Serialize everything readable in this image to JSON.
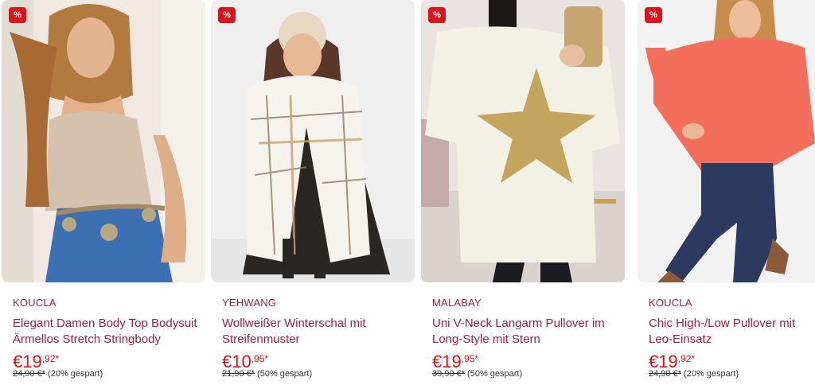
{
  "badge": "%",
  "colors": {
    "brand_text": "#9a2145",
    "price": "#d9141c",
    "badge_bg": "#d9141c"
  },
  "products": [
    {
      "brand": "KOUCLA",
      "title": "Elegant Damen Body Top Bodysuit Ärmellos Stretch Stringbody",
      "price_main": "€19",
      "price_cents": ",92*",
      "old_price": "24,90 €*",
      "savings": "(20% gespart)"
    },
    {
      "brand": "YEHWANG",
      "title": "Wollweißer Winterschal mit Streifenmuster",
      "price_main": "€10",
      "price_cents": ",95*",
      "old_price": "21,90 €*",
      "savings": "(50% gespart)"
    },
    {
      "brand": "MALABAY",
      "title": "Uni V-Neck Langarm Pullover im Long-Style mit Stern",
      "price_main": "€19",
      "price_cents": ",95*",
      "old_price": "39,90 €*",
      "savings": "(50% gespart)"
    },
    {
      "brand": "KOUCLA",
      "title": "Chic High-/Low Pullover mit Leo-Einsatz",
      "price_main": "€19",
      "price_cents": ",92*",
      "old_price": "24,90 €*",
      "savings": "(20% gespart)"
    }
  ]
}
